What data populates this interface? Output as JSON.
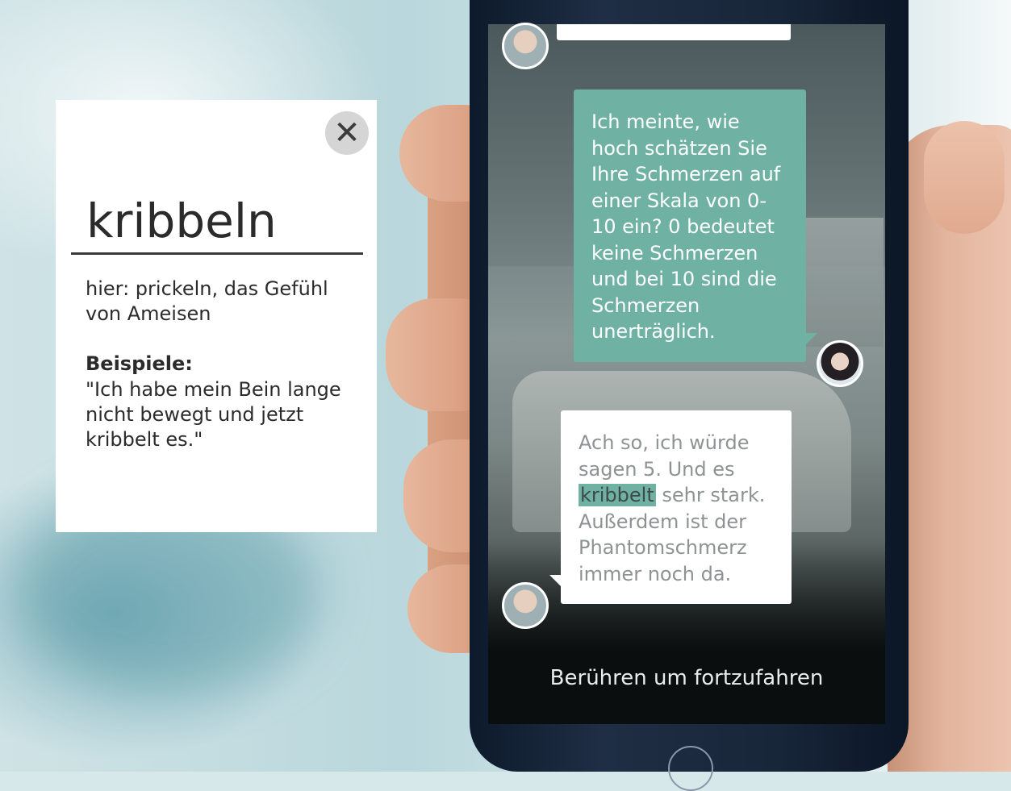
{
  "dictionary": {
    "word": "kribbeln",
    "definition": "hier: prickeln, das Gefühl von Ameisen",
    "examples_label": "Beispiele:",
    "example_text": "\"Ich habe mein Bein lange nicht bewegt und jetzt kribbelt es.\"",
    "close_icon": "close-icon"
  },
  "chat": {
    "message_1": "Ich meinte, wie hoch schätzen Sie Ihre Schmerzen auf einer Skala von 0-10 ein? 0 bedeutet keine Schmerzen und bei 10 sind die Schmerzen unerträglich.",
    "message_2_before": "Ach so, ich würde sagen 5. Und es",
    "message_2_highlight": "kribbelt",
    "message_2_after": "sehr stark. Außerdem ist der Phantomschmerz immer noch da.",
    "continue_label": "Berühren um fortzufahren"
  },
  "colors": {
    "accent": "#6fb1a3"
  }
}
